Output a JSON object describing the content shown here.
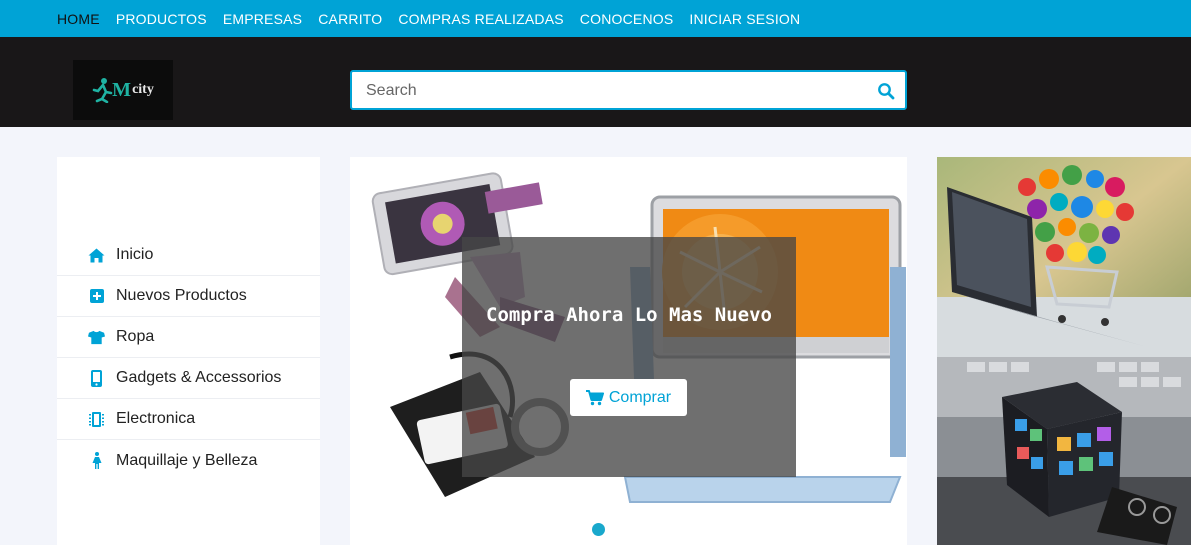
{
  "nav": {
    "items": [
      {
        "label": "HOME",
        "active": true
      },
      {
        "label": "PRODUCTOS"
      },
      {
        "label": "EMPRESAS"
      },
      {
        "label": "CARRITO"
      },
      {
        "label": "COMPRAS REALIZADAS"
      },
      {
        "label": "CONOCENOS"
      },
      {
        "label": "INICIAR SESION"
      }
    ]
  },
  "header": {
    "logo_text_m": "M",
    "logo_text_city": "city",
    "search": {
      "placeholder": "Search",
      "value": ""
    }
  },
  "sidebar": {
    "items": [
      {
        "label": "Inicio",
        "icon": "home-icon"
      },
      {
        "label": "Nuevos Productos",
        "icon": "plus-square-icon"
      },
      {
        "label": "Ropa",
        "icon": "shirt-icon"
      },
      {
        "label": "Gadgets & Accessorios",
        "icon": "mobile-icon"
      },
      {
        "label": "Electronica",
        "icon": "chip-icon"
      },
      {
        "label": "Maquillaje y Belleza",
        "icon": "female-icon"
      }
    ]
  },
  "carousel": {
    "title": "Compra Ahora Lo Mas Nuevo",
    "button_label": "Comprar",
    "button_icon": "cart-icon"
  },
  "colors": {
    "accent": "#00a3d6",
    "header_bg": "#191718",
    "page_bg": "#f3f5fb"
  }
}
